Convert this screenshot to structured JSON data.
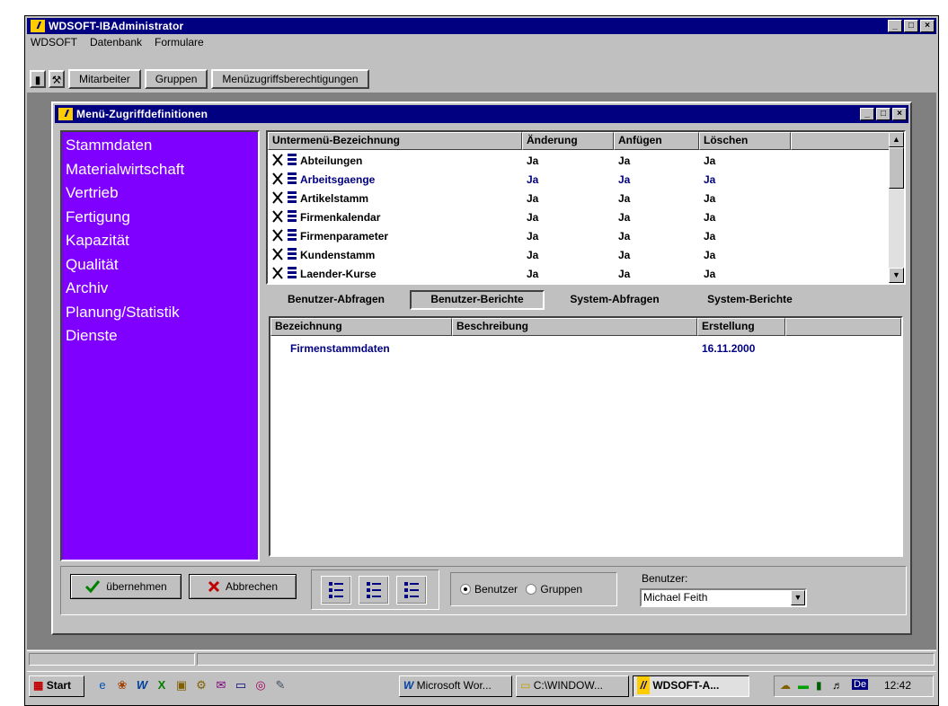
{
  "window": {
    "title": "WDSOFT-IBAdministrator",
    "controls": [
      "_",
      "□",
      "×"
    ]
  },
  "menu": [
    "WDSOFT",
    "Datenbank",
    "Formulare"
  ],
  "toolbar": {
    "buttons": [
      "Mitarbeiter",
      "Gruppen",
      "Menüzugriffsberechtigungen"
    ]
  },
  "child": {
    "title": "Menü-Zugriffdefinitionen",
    "categories": [
      "Stammdaten",
      "Materialwirtschaft",
      "Vertrieb",
      "Fertigung",
      "Kapazität",
      "Qualität",
      "Archiv",
      "Planung/Statistik",
      "Dienste"
    ],
    "submenu_grid": {
      "headers": [
        "Untermenü-Bezeichnung",
        "Änderung",
        "Anfügen",
        "Löschen"
      ],
      "rows": [
        {
          "name": "Abteilungen",
          "aenderung": "Ja",
          "anfuegen": "Ja",
          "loeschen": "Ja"
        },
        {
          "name": "Arbeitsgaenge",
          "aenderung": "Ja",
          "anfuegen": "Ja",
          "loeschen": "Ja"
        },
        {
          "name": "Artikelstamm",
          "aenderung": "Ja",
          "anfuegen": "Ja",
          "loeschen": "Ja"
        },
        {
          "name": "Firmenkalendar",
          "aenderung": "Ja",
          "anfuegen": "Ja",
          "loeschen": "Ja"
        },
        {
          "name": "Firmenparameter",
          "aenderung": "Ja",
          "anfuegen": "Ja",
          "loeschen": "Ja"
        },
        {
          "name": "Kundenstamm",
          "aenderung": "Ja",
          "anfuegen": "Ja",
          "loeschen": "Ja"
        },
        {
          "name": "Laender-Kurse",
          "aenderung": "Ja",
          "anfuegen": "Ja",
          "loeschen": "Ja"
        }
      ]
    },
    "tabs": [
      "Benutzer-Abfragen",
      "Benutzer-Berichte",
      "System-Abfragen",
      "System-Berichte"
    ],
    "report_grid": {
      "headers": [
        "Bezeichnung",
        "Beschreibung",
        "Erstellung"
      ],
      "rows": [
        {
          "bezeichnung": "Firmenstammdaten",
          "beschreibung": "",
          "erstellung": "16.11.2000"
        }
      ]
    },
    "buttons": {
      "apply": "übernehmen",
      "cancel": "Abbrechen"
    },
    "radio": {
      "user": "Benutzer",
      "group": "Gruppen"
    },
    "user_label": "Benutzer:",
    "user_value": "Michael Feith"
  },
  "taskbar": {
    "start": "Start",
    "tasks": [
      "Microsoft Wor...",
      "C:\\WINDOW...",
      "WDSOFT-A..."
    ],
    "lang": "De",
    "clock": "12:42"
  }
}
